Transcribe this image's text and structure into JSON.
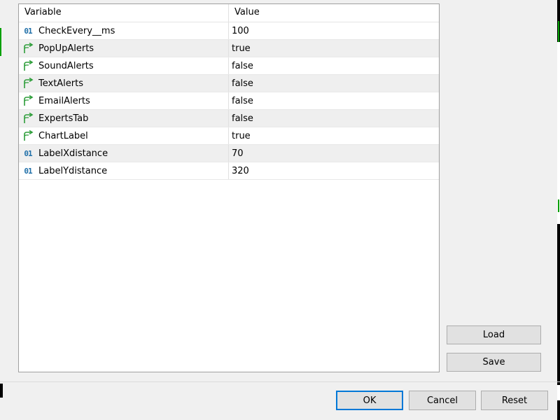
{
  "grid": {
    "headers": {
      "variable": "Variable",
      "value": "Value"
    },
    "rows": [
      {
        "name": "CheckEvery__ms",
        "value": "100",
        "type": "int",
        "icon": "number-01-icon"
      },
      {
        "name": "PopUpAlerts",
        "value": "true",
        "type": "bool",
        "icon": "bool-arrow-icon"
      },
      {
        "name": "SoundAlerts",
        "value": "false",
        "type": "bool",
        "icon": "bool-arrow-icon"
      },
      {
        "name": "TextAlerts",
        "value": "false",
        "type": "bool",
        "icon": "bool-arrow-icon"
      },
      {
        "name": "EmailAlerts",
        "value": "false",
        "type": "bool",
        "icon": "bool-arrow-icon"
      },
      {
        "name": "ExpertsTab",
        "value": "false",
        "type": "bool",
        "icon": "bool-arrow-icon"
      },
      {
        "name": "ChartLabel",
        "value": "true",
        "type": "bool",
        "icon": "bool-arrow-icon"
      },
      {
        "name": "LabelXdistance",
        "value": "70",
        "type": "int",
        "icon": "number-01-icon"
      },
      {
        "name": "LabelYdistance",
        "value": "320",
        "type": "int",
        "icon": "number-01-icon"
      }
    ],
    "int_icon_text": "01"
  },
  "side_buttons": {
    "load": "Load",
    "save": "Save"
  },
  "footer_buttons": {
    "ok": "OK",
    "cancel": "Cancel",
    "reset": "Reset"
  },
  "colors": {
    "int_icon": "#1f6fa8",
    "bool_icon": "#2e9e3a",
    "primary_border": "#0078d7"
  }
}
